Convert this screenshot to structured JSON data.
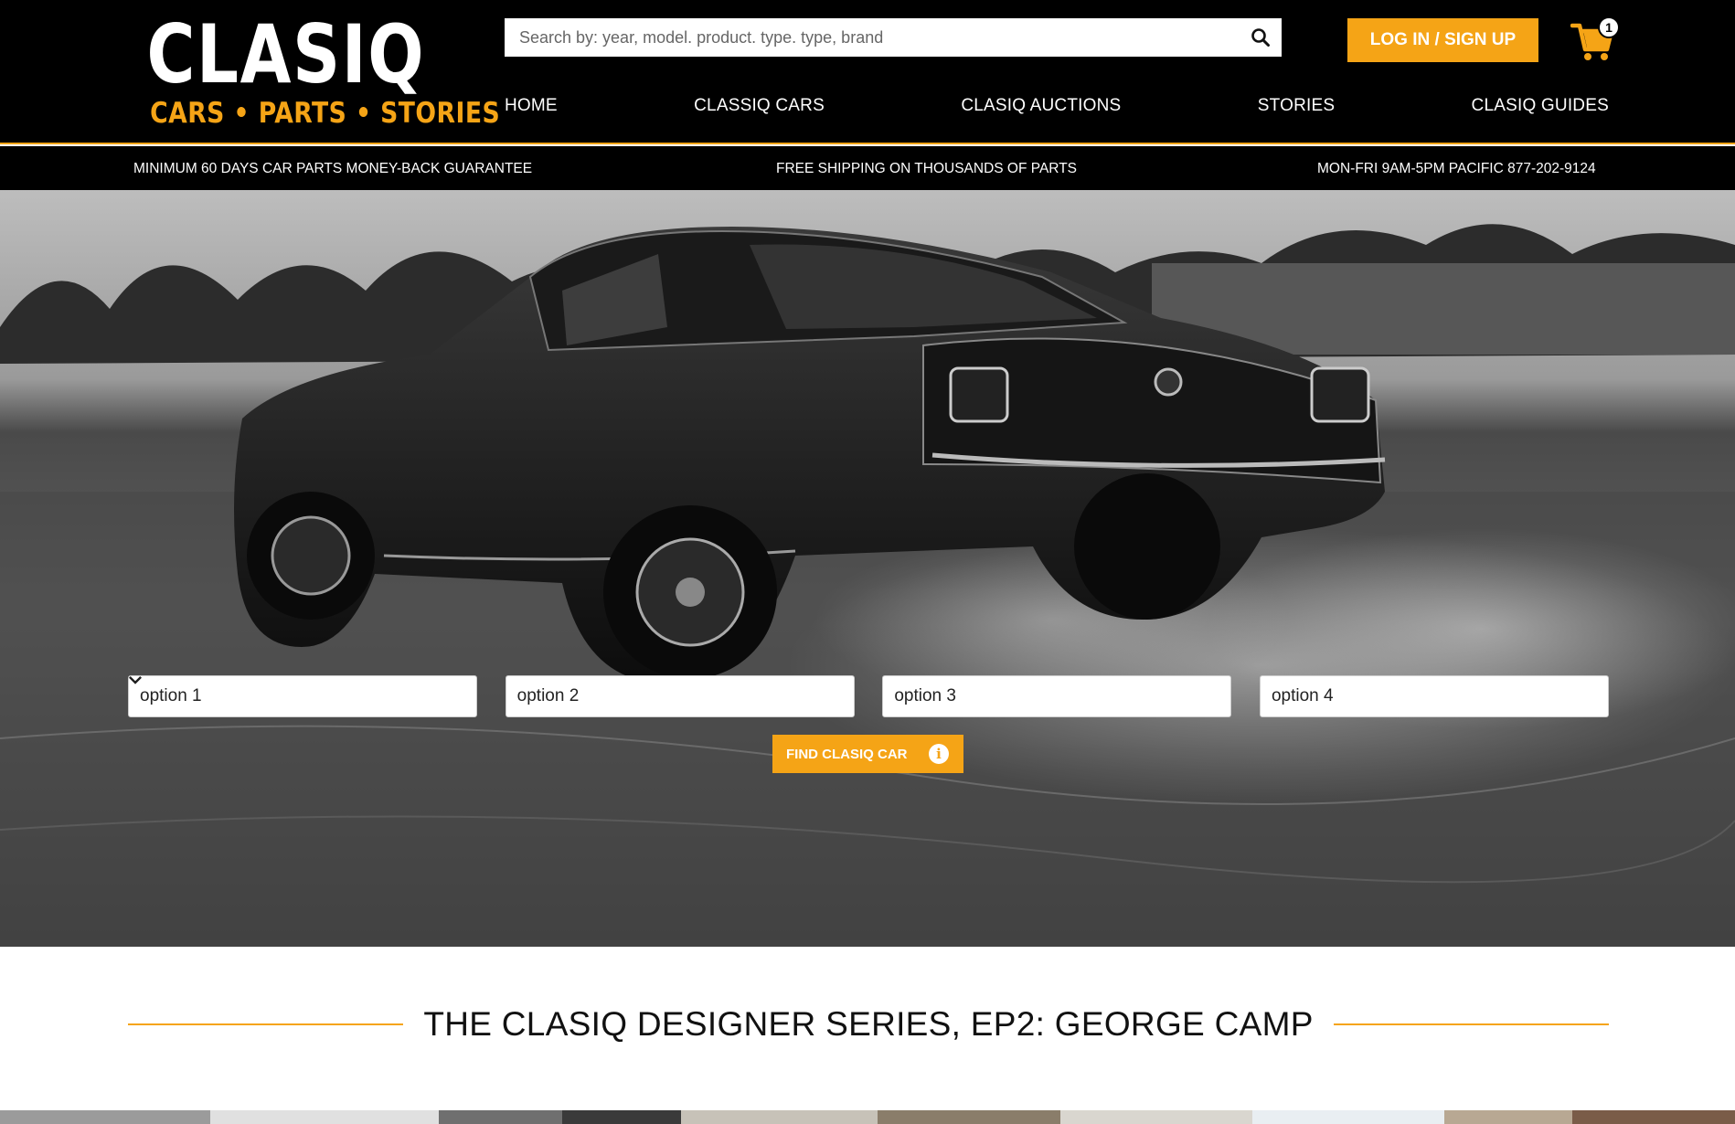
{
  "brand": {
    "logo_text": "CLASIQ",
    "tagline": "CARS • PARTS • STORIES",
    "accent_color": "#f5a416"
  },
  "search": {
    "placeholder": "Search by: year, model. product. type. type, brand",
    "icon": "search-icon"
  },
  "header": {
    "login_label": "LOG IN / SIGN UP",
    "cart_count": "1",
    "cart_icon": "shopping-cart-icon"
  },
  "nav": {
    "items": [
      {
        "label": "HOME"
      },
      {
        "label": "CLASSIQ CARS"
      },
      {
        "label": "CLASIQ AUCTIONS"
      },
      {
        "label": "STORIES"
      },
      {
        "label": "CLASIQ GUIDES"
      }
    ]
  },
  "infobar": {
    "guarantee": "MINIMUM 60 DAYS CAR PARTS MONEY-BACK GUARANTEE",
    "shipping": "FREE SHIPPING ON THOUSANDS OF PARTS",
    "hours": "MON-FRI 9AM-5PM PACIFIC 877-202-9124"
  },
  "finder": {
    "selects": [
      {
        "value": "option 1"
      },
      {
        "value": "option 2"
      },
      {
        "value": "option 3"
      },
      {
        "value": "option 4"
      }
    ],
    "button_label": "FIND CLASIQ CAR",
    "info_icon": "info-icon"
  },
  "story": {
    "title": "THE CLASIQ DESIGNER SERIES, EP2: GEORGE CAMP"
  }
}
